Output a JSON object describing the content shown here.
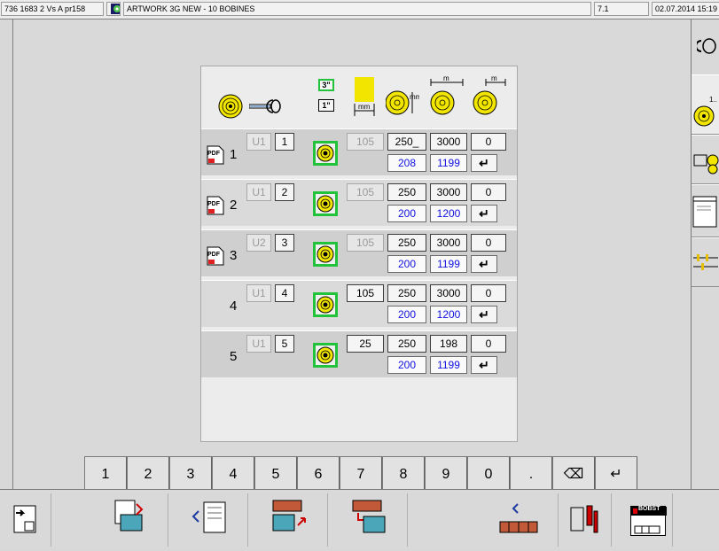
{
  "titlebar": {
    "job_id": "736 1683 2 Vs A pr158",
    "app_title": "ARTWORK 3G NEW - 10 BOBINES",
    "version": "7.1",
    "datetime": "02.07.2014 15:19"
  },
  "header_labels": {
    "core_3": "3\"",
    "core_1": "1\"",
    "mm": "mm",
    "mm2": "mm",
    "m1": "m",
    "m2": "m"
  },
  "rows": [
    {
      "num": "1",
      "has_pdf": true,
      "pdf_label": "PDF",
      "unit": "U1",
      "pos": "1",
      "width": "105",
      "width_disabled": true,
      "diam": "250_",
      "length": "3000",
      "count": "0",
      "actual_diam": "208",
      "actual_length": "1199",
      "enter": "↵"
    },
    {
      "num": "2",
      "has_pdf": true,
      "pdf_label": "PDF",
      "unit": "U1",
      "pos": "2",
      "width": "105",
      "width_disabled": true,
      "diam": "250",
      "length": "3000",
      "count": "0",
      "actual_diam": "200",
      "actual_length": "1200",
      "enter": "↵"
    },
    {
      "num": "3",
      "has_pdf": true,
      "pdf_label": "PDF",
      "unit": "U2",
      "pos": "3",
      "width": "105",
      "width_disabled": true,
      "diam": "250",
      "length": "3000",
      "count": "0",
      "actual_diam": "200",
      "actual_length": "1199",
      "enter": "↵"
    },
    {
      "num": "4",
      "has_pdf": false,
      "pdf_label": "",
      "unit": "U1",
      "pos": "4",
      "width": "105",
      "width_disabled": false,
      "diam": "250",
      "length": "3000",
      "count": "0",
      "actual_diam": "200",
      "actual_length": "1200",
      "enter": "↵"
    },
    {
      "num": "5",
      "has_pdf": false,
      "pdf_label": "",
      "unit": "U1",
      "pos": "5",
      "width": "25",
      "width_disabled": false,
      "diam": "250",
      "length": "198",
      "count": "0",
      "actual_diam": "200",
      "actual_length": "1199",
      "enter": "↵"
    }
  ],
  "keypad": {
    "keys": [
      "1",
      "2",
      "3",
      "4",
      "5",
      "6",
      "7",
      "8",
      "9",
      "0",
      ".",
      "⌫",
      "↵"
    ]
  },
  "bottombar": {
    "bobst_label": "BOBST"
  },
  "colors": {
    "accent_green": "#22c33a",
    "coil_yellow": "#f2e600",
    "actual_blue": "#1010e0"
  }
}
